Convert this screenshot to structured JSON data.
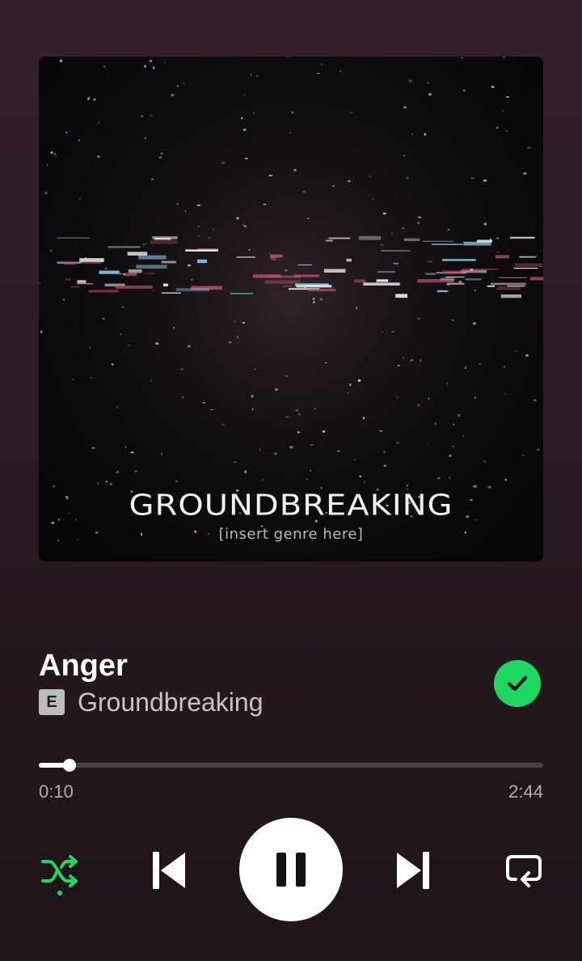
{
  "album_art": {
    "title": "GROUNDBREAKING",
    "subtitle": "[insert genre here]"
  },
  "track": {
    "title": "Anger",
    "explicit_label": "E",
    "artist": "Groundbreaking",
    "liked": true
  },
  "playback": {
    "elapsed": "0:10",
    "total": "2:44",
    "progress_fraction": 0.061,
    "state": "playing"
  },
  "controls": {
    "shuffle_icon": "shuffle-icon",
    "shuffle_active": true,
    "previous_icon": "skip-previous-icon",
    "play_pause_icon": "pause-icon",
    "next_icon": "skip-next-icon",
    "repeat_icon": "repeat-icon"
  },
  "colors": {
    "accent": "#1ed760",
    "background_top": "#34202b",
    "background_bottom": "#1d1519"
  }
}
